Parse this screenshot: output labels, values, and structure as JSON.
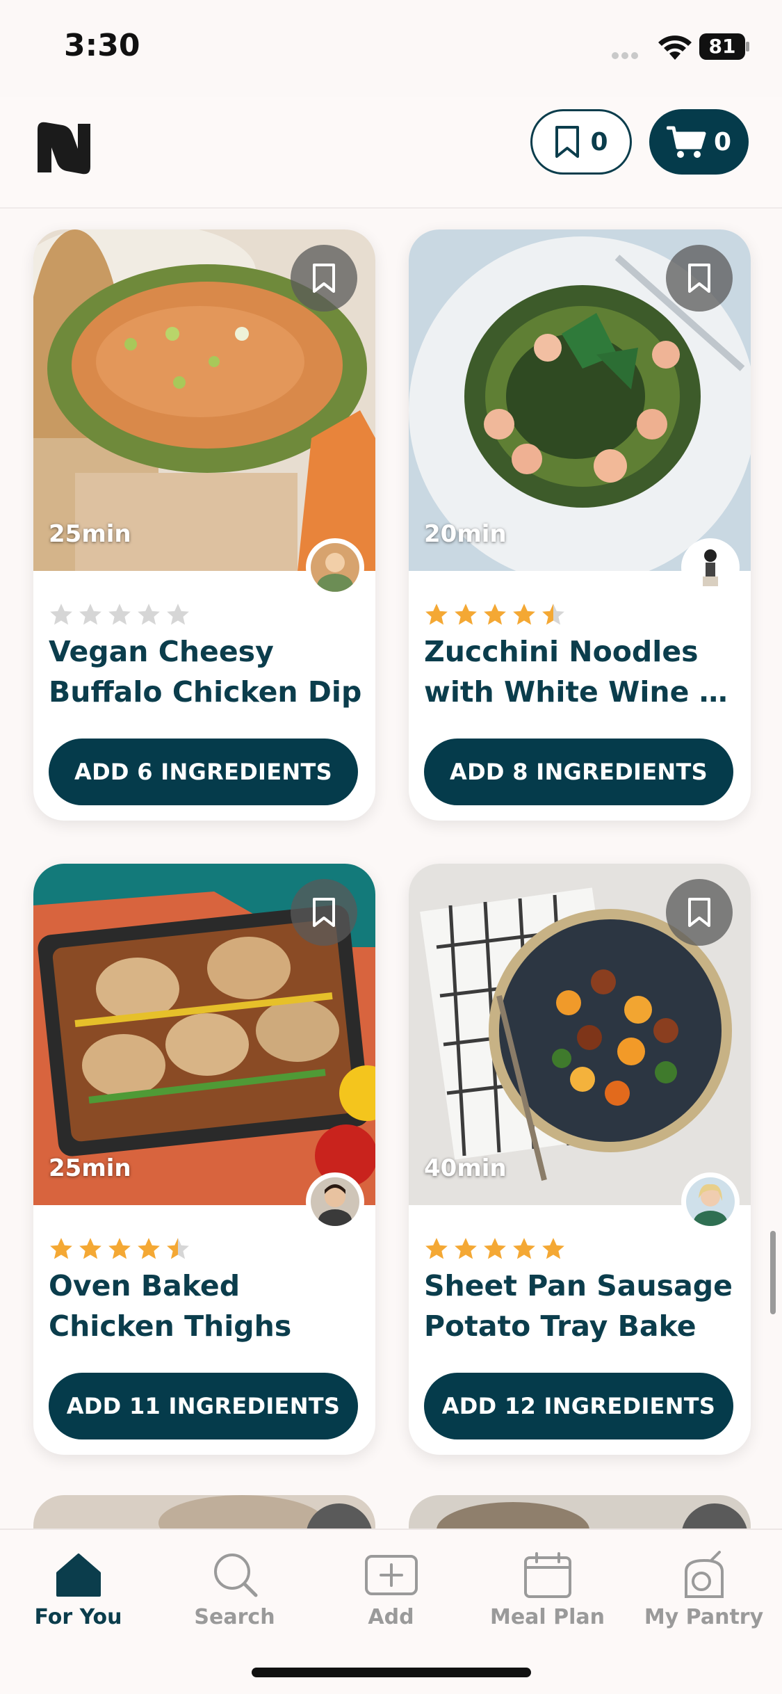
{
  "status_bar": {
    "time": "3:30",
    "battery": "81"
  },
  "header": {
    "saved_count": "0",
    "cart_count": "0"
  },
  "recipes": [
    {
      "time": "25min",
      "title_line1": "Vegan Cheesy",
      "title_line2": "Buffalo Chicken Dip",
      "rating": 0,
      "button": "ADD 6 INGREDIENTS"
    },
    {
      "time": "20min",
      "title_line1": "Zucchini Noodles",
      "title_line2": "with White Wine S...",
      "rating": 4.5,
      "button": "ADD 8 INGREDIENTS"
    },
    {
      "time": "25min",
      "title_line1": "Oven Baked",
      "title_line2": "Chicken Thighs",
      "rating": 4.5,
      "button": "ADD 11 INGREDIENTS"
    },
    {
      "time": "40min",
      "title_line1": "Sheet Pan Sausage",
      "title_line2": "Potato Tray Bake",
      "rating": 5,
      "button": "ADD 12 INGREDIENTS"
    }
  ],
  "tabs": [
    {
      "label": "For You",
      "icon": "home-icon",
      "active": true
    },
    {
      "label": "Search",
      "icon": "search-icon",
      "active": false
    },
    {
      "label": "Add",
      "icon": "add-icon",
      "active": false
    },
    {
      "label": "Meal Plan",
      "icon": "calendar-icon",
      "active": false
    },
    {
      "label": "My Pantry",
      "icon": "pantry-icon",
      "active": false
    }
  ],
  "colors": {
    "brand": "#053b4b",
    "star": "#f4a834",
    "star_empty": "#d6d6d6",
    "tab_inactive": "#9a9a9a"
  }
}
